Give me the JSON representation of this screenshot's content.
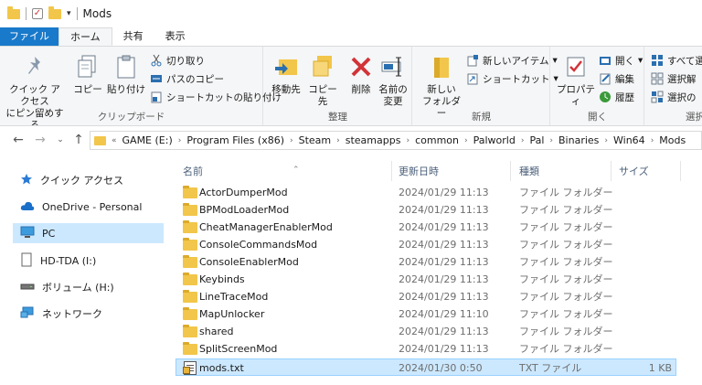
{
  "window": {
    "title": "Mods"
  },
  "tabs": [
    {
      "label": "ファイル"
    },
    {
      "label": "ホーム"
    },
    {
      "label": "共有"
    },
    {
      "label": "表示"
    }
  ],
  "ribbon": {
    "clipboard": {
      "label": "クリップボード",
      "pin_line1": "クイック アクセス",
      "pin_line2": "にピン留めする",
      "copy": "コピー",
      "paste": "貼り付け",
      "cut": "切り取り",
      "copy_path": "パスのコピー",
      "paste_shortcut": "ショートカットの貼り付け"
    },
    "organize": {
      "label": "整理",
      "move_to": "移動先",
      "copy_to": "コピー先",
      "delete": "削除",
      "rename_line1": "名前の",
      "rename_line2": "変更"
    },
    "new": {
      "label": "新規",
      "new_folder_line1": "新しい",
      "new_folder_line2": "フォルダー",
      "new_item": "新しいアイテム",
      "shortcut": "ショートカット"
    },
    "open": {
      "label": "開く",
      "properties": "プロパティ",
      "open": "開く",
      "edit": "編集",
      "history": "履歴"
    },
    "select": {
      "label": "選択",
      "select_all": "すべて選",
      "select_none": "選択解",
      "invert": "選択の"
    }
  },
  "address": {
    "crumbs": [
      "GAME (E:)",
      "Program Files (x86)",
      "Steam",
      "steamapps",
      "common",
      "Palworld",
      "Pal",
      "Binaries",
      "Win64",
      "Mods"
    ]
  },
  "nav": {
    "items": [
      {
        "label": "クイック アクセス",
        "icon": "star-icon"
      },
      {
        "label": "OneDrive - Personal",
        "icon": "cloud-icon"
      },
      {
        "label": "PC",
        "icon": "pc-icon",
        "selected": true
      },
      {
        "label": "HD-TDA (I:)",
        "icon": "drive-icon"
      },
      {
        "label": "ボリューム (H:)",
        "icon": "drive-icon"
      },
      {
        "label": "ネットワーク",
        "icon": "network-icon"
      }
    ]
  },
  "columns": {
    "name": "名前",
    "date": "更新日時",
    "type": "種類",
    "size": "サイズ"
  },
  "files": [
    {
      "name": "ActorDumperMod",
      "date": "2024/01/29 11:13",
      "type": "ファイル フォルダー",
      "size": "",
      "kind": "folder"
    },
    {
      "name": "BPModLoaderMod",
      "date": "2024/01/29 11:13",
      "type": "ファイル フォルダー",
      "size": "",
      "kind": "folder"
    },
    {
      "name": "CheatManagerEnablerMod",
      "date": "2024/01/29 11:13",
      "type": "ファイル フォルダー",
      "size": "",
      "kind": "folder"
    },
    {
      "name": "ConsoleCommandsMod",
      "date": "2024/01/29 11:13",
      "type": "ファイル フォルダー",
      "size": "",
      "kind": "folder"
    },
    {
      "name": "ConsoleEnablerMod",
      "date": "2024/01/29 11:13",
      "type": "ファイル フォルダー",
      "size": "",
      "kind": "folder"
    },
    {
      "name": "Keybinds",
      "date": "2024/01/29 11:13",
      "type": "ファイル フォルダー",
      "size": "",
      "kind": "folder"
    },
    {
      "name": "LineTraceMod",
      "date": "2024/01/29 11:13",
      "type": "ファイル フォルダー",
      "size": "",
      "kind": "folder"
    },
    {
      "name": "MapUnlocker",
      "date": "2024/01/29 11:10",
      "type": "ファイル フォルダー",
      "size": "",
      "kind": "folder"
    },
    {
      "name": "shared",
      "date": "2024/01/29 11:13",
      "type": "ファイル フォルダー",
      "size": "",
      "kind": "folder"
    },
    {
      "name": "SplitScreenMod",
      "date": "2024/01/29 11:13",
      "type": "ファイル フォルダー",
      "size": "",
      "kind": "folder"
    },
    {
      "name": "mods.txt",
      "date": "2024/01/30 0:50",
      "type": "TXT ファイル",
      "size": "1 KB",
      "kind": "txt",
      "selected": true
    }
  ]
}
